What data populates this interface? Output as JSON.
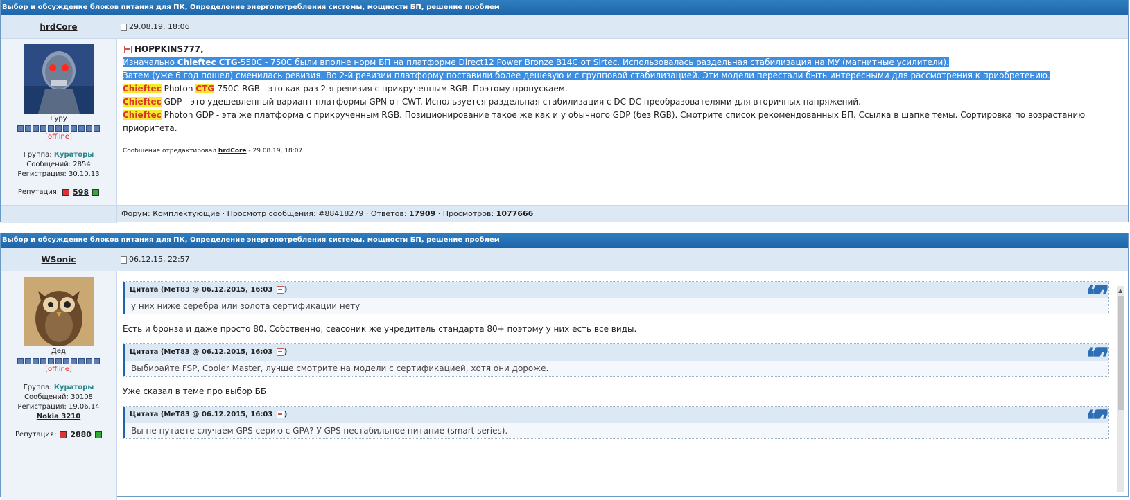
{
  "topic_title": "Выбор и обсуждение блоков питания для ПК, Определение энергопотребления системы, мощности БП, решение проблем",
  "post1": {
    "author": "hrdCore",
    "date": "29.08.19, 18:06",
    "rank": "Гуру",
    "status": "[offline]",
    "group_label": "Группа:",
    "group": "Кураторы",
    "messages": "Сообщений: 2854",
    "registered": "Регистрация: 30.10.13",
    "rep_label": "Репутация:",
    "rep_value": "598",
    "reply_to": "HOPPKINS777,",
    "l1a": "Изначально ",
    "l1b": "Chieftec CTG",
    "l1c": "-550C - 750C были вполне норм БП на платформе Direct12 Power Bronze B14C от Sirtec. Использовалась раздельная стабилизация на МУ (магнитные усилители).",
    "l2": "Затем (уже 6 год пошел) сменилась ревизия. Во 2-й ревизии платформу поставили более дешевую и с групповой стабилизацией. Эти модели перестали быть интересными для рассмотрения к приобретению.",
    "brand": "Chieftec",
    "ctg": "CTG",
    "l3a": " Photon ",
    "l3b": "-750C-RGB - это как раз 2-я ревизия с прикрученным RGB. Поэтому пропускаем.",
    "l4": " GDP - это удешевленный вариант платформы GPN от CWT. Используется раздельная стабилизация с DC-DC преобразователями для вторичных напряжений.",
    "l5": " Photon GDP - эта же платформа с прикрученным RGB. Позиционирование такое же как и у обычного GDP (без RGB). Смотрите список рекомендованных БП. Ссылка в шапке темы. Сортировка по возрастанию приоритета.",
    "edited_prefix": "Сообщение отредактировал ",
    "edited_user": "hrdCore",
    "edited_suffix": " - 29.08.19, 18:07",
    "footer": {
      "forum_label": "Форум: ",
      "forum": "Комплектующие",
      "view_label": " · Просмотр сообщения: ",
      "msg_id": "#88418279",
      "answers_label": " · Ответов: ",
      "answers": "17909",
      "views_label": " · Просмотров: ",
      "views": "1077666"
    }
  },
  "post2": {
    "author": "WSonic",
    "date": "06.12.15, 22:57",
    "rank": "Дед",
    "status": "[offline]",
    "group_label": "Группа:",
    "group": "Кураторы",
    "messages": "Сообщений: 30108",
    "registered": "Регистрация: 19.06.14",
    "car": "Nokia 3210",
    "rep_label": "Репутация:",
    "rep_value": "2880",
    "q1_head": "Цитата (MeT83 @ 06.12.2015, 16:03",
    "q1_text": "у них ниже серебра или золота сертификации нету",
    "p1": "Есть и бронза и даже просто 80. Собственно, сеасоник же учредитель стандарта 80+ поэтому у них есть все виды.",
    "q2_head": "Цитата (MeT83 @ 06.12.2015, 16:03",
    "q2_text": "Выбирайте FSP, Cooler Master, лучше смотрите на модели с сертификацией, хотя они дороже.",
    "p2": "Уже сказал в теме про выбор ББ",
    "q3_head": "Цитата (MeT83 @ 06.12.2015, 16:03",
    "q3_text": "Вы не путаете случаем GPS серию с GPA? У GPS нестабильное питание (smart series).",
    "close_paren": ")"
  },
  "quote_mark": "❝❞",
  "colors": {
    "header": "#1f64a8",
    "highlight": "#3d8de0",
    "brand_bg": "#f5ea2a",
    "brand_fg": "#e03030"
  }
}
